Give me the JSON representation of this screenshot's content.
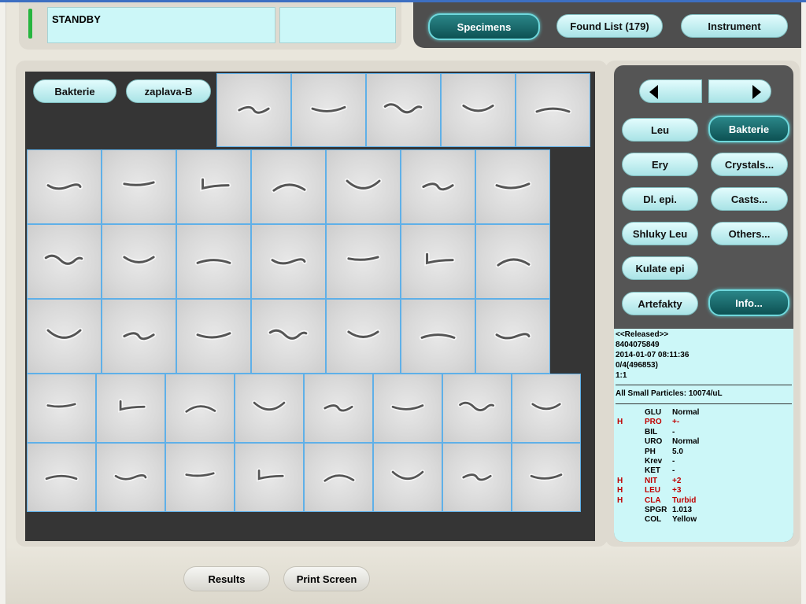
{
  "status": {
    "text": "STANDBY",
    "secondary": ""
  },
  "topnav": {
    "specimens": "Specimens",
    "found_list": "Found List (179)",
    "instrument": "Instrument"
  },
  "gallery": {
    "class_tag": "Bakterie",
    "sample_tag": "zaplava-B"
  },
  "class_buttons": {
    "leu": "Leu",
    "bakterie": "Bakterie",
    "ery": "Ery",
    "crystals": "Crystals...",
    "dl_epi": "Dl. epi.",
    "casts": "Casts...",
    "shluky_leu": "Shluky Leu",
    "others": "Others...",
    "kulate_epi": "Kulate epi",
    "artefakty": "Artefakty",
    "info": "Info..."
  },
  "info": {
    "status": "<<Released>>",
    "sample_id": "8404075849",
    "datetime": "2014-01-07 08:11:36",
    "position": "0/4(496853)",
    "dilution": "1:1",
    "particles": "All Small Particles: 10074/uL",
    "chemistry": [
      {
        "flag": "",
        "name": "GLU",
        "value": "Normal"
      },
      {
        "flag": "H",
        "name": "PRO",
        "value": "+-"
      },
      {
        "flag": "",
        "name": "BIL",
        "value": "-"
      },
      {
        "flag": "",
        "name": "URO",
        "value": "Normal"
      },
      {
        "flag": "",
        "name": "PH",
        "value": "5.0"
      },
      {
        "flag": "",
        "name": "Krev",
        "value": "-"
      },
      {
        "flag": "",
        "name": "KET",
        "value": "-"
      },
      {
        "flag": "H",
        "name": "NIT",
        "value": "+2"
      },
      {
        "flag": "H",
        "name": "LEU",
        "value": "+3"
      },
      {
        "flag": "H",
        "name": "CLA",
        "value": "Turbid"
      },
      {
        "flag": "",
        "name": "SPGR",
        "value": "1.013"
      },
      {
        "flag": "",
        "name": "COL",
        "value": "Yellow"
      }
    ]
  },
  "bottom": {
    "results": "Results",
    "print_screen": "Print Screen"
  },
  "colors": {
    "accent_active": "#0d5153",
    "pill": "#a9e3e6",
    "tile_border": "#5fb0e8",
    "info_bg": "#ccf7f8",
    "flag_high": "#c00000",
    "status_led": "#27b53f"
  }
}
